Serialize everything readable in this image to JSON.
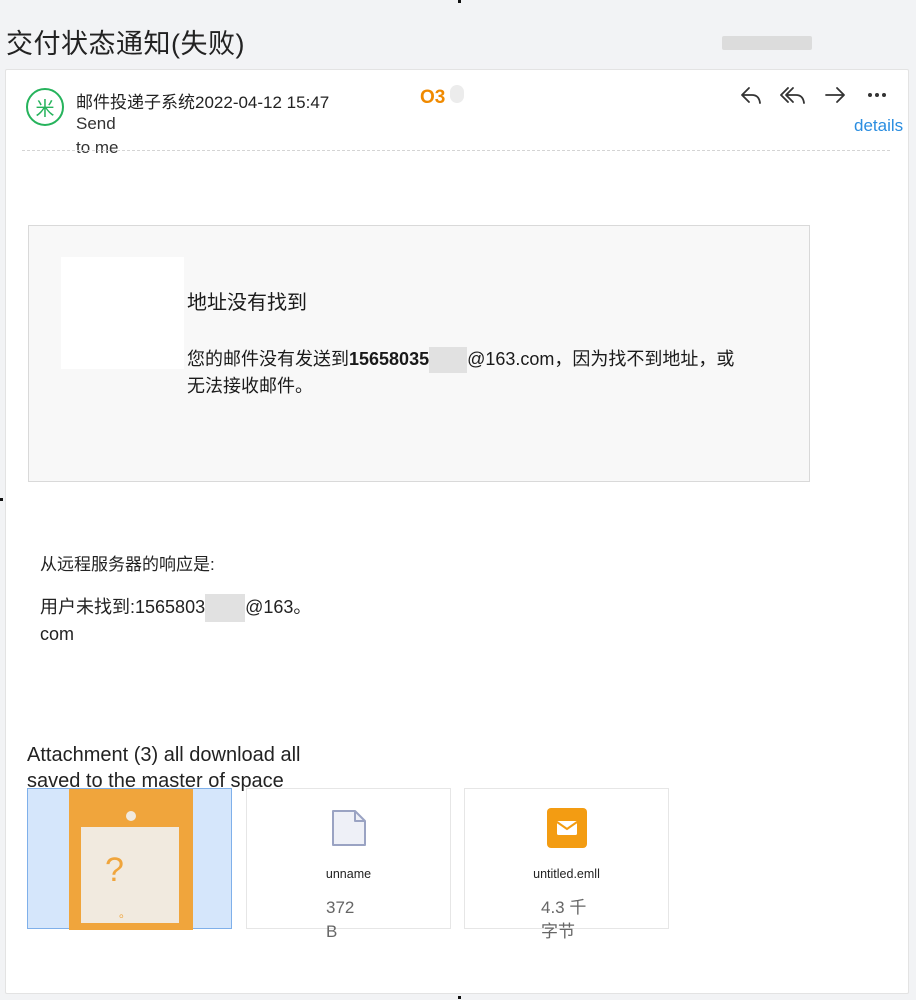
{
  "page": {
    "title": "交付状态通知(失败)"
  },
  "header": {
    "avatar_glyph": "米",
    "sender": "邮件投递子系统",
    "date": "2022-04-12 15:47",
    "status_badge": "O3",
    "send_label": "Send",
    "to_label": "to me",
    "details_link": "details"
  },
  "actions": [
    {
      "name": "reply-icon"
    },
    {
      "name": "reply-all-icon"
    },
    {
      "name": "forward-icon"
    },
    {
      "name": "more-icon"
    }
  ],
  "notice": {
    "heading": "地址没有找到",
    "body_prefix": "您的邮件没有发送到",
    "email_visible_start": "15658035",
    "email_domain": "@163.com",
    "body_suffix": "，因为找不到地址，或无法接收邮件。"
  },
  "response": {
    "label": "从远程服务器的响应是:",
    "prefix": "用户未找到:",
    "email_visible_start": "1565803",
    "email_domain": "@163。",
    "email_tail": "com"
  },
  "attachments": {
    "title": "Attachment (3) all download all saved to the master of space",
    "items": [
      {
        "name": "",
        "size": "",
        "icon": "broken-image-icon",
        "selected": true
      },
      {
        "name": "unname",
        "size": "372 B",
        "icon": "file-icon"
      },
      {
        "name": "untitled.emll",
        "size": "4.3 千字节",
        "icon": "mail-icon"
      }
    ]
  },
  "colors": {
    "accent": "#2a8de0",
    "badge": "#f08a00",
    "avatar": "#26b35c",
    "mail": "#f39c12"
  }
}
